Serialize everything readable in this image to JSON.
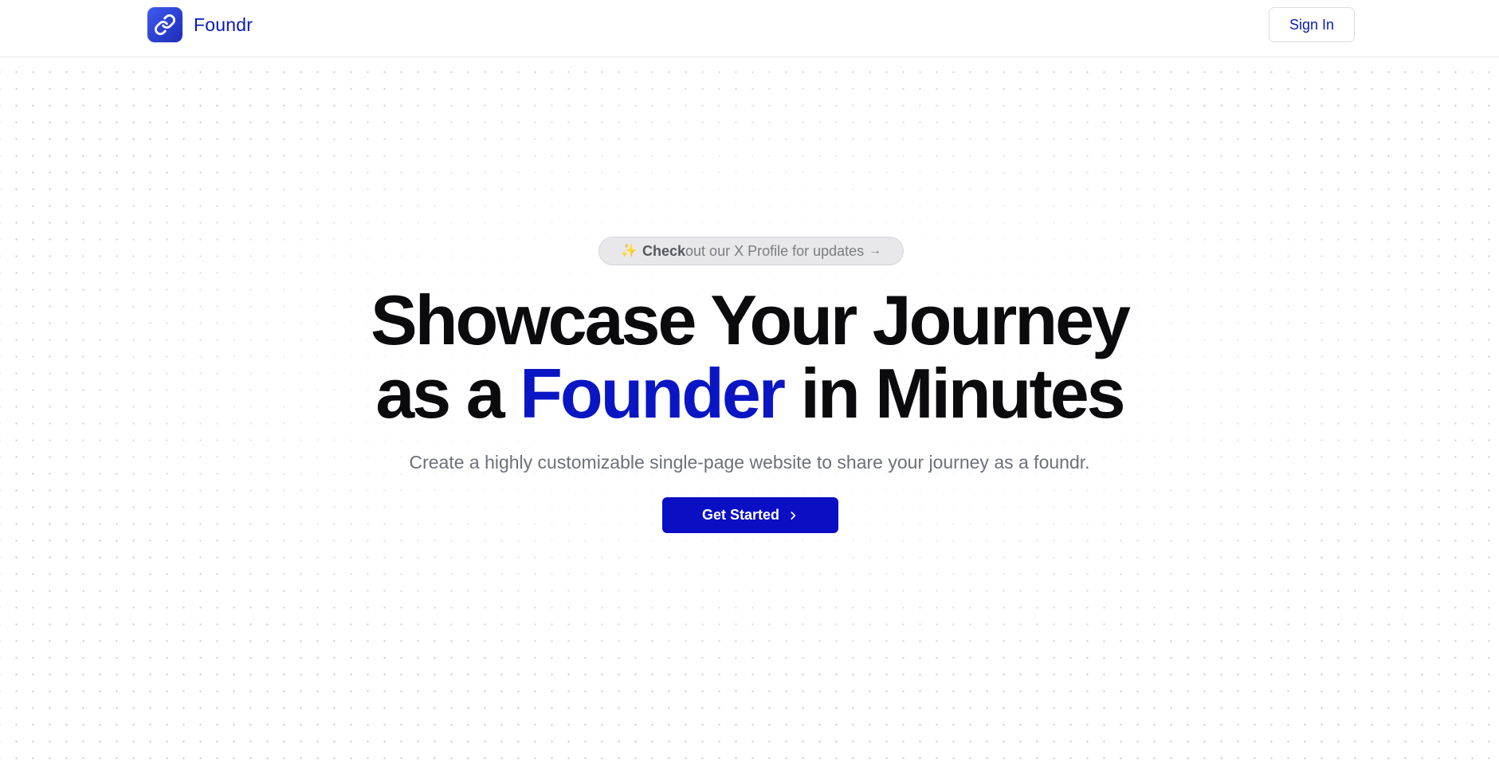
{
  "header": {
    "brand_name": "Foundr",
    "sign_in_label": "Sign In"
  },
  "hero": {
    "announcement": {
      "bold_text": "Check",
      "rest_text": "out our X Profile for updates",
      "arrow": "→",
      "sparkle": "✨"
    },
    "headline": {
      "line1": "Showcase Your Journey",
      "line2_before": "as a ",
      "line2_accent": "Founder",
      "line2_after": " in Minutes"
    },
    "subtitle": "Create a highly customizable single-page website to share your journey as a foundr.",
    "cta_label": "Get Started"
  },
  "icons": {
    "logo": "link-icon",
    "cta": "chevron-right-icon",
    "announcement": "sparkle-icon"
  },
  "colors": {
    "brand": "#0a1bb7",
    "accent": "#0a16c4",
    "cta_background": "#0a0fc4",
    "text": "#0b0b0d",
    "muted": "#6d7079"
  }
}
